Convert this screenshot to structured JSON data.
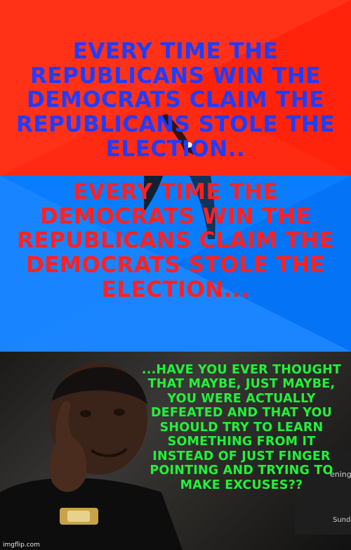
{
  "panels": {
    "top_caption": "EVERY TIME THE REPUBLICANS WIN THE DEMOCRATS CLAIM THE REPUBLICANS STOLE THE ELECTION..",
    "middle_caption": "EVERY TIME THE DEMOCRATS WIN THE REPUBLICANS CLAIM THE DEMOCRATS STOLE THE ELECTION...",
    "bottom_caption": "...HAVE YOU EVER THOUGHT THAT MAYBE, JUST MAYBE, YOU WERE ACTUALLY DEFEATED AND THAT YOU SHOULD TRY TO LEARN SOMETHING FROM IT INSTEAD OF JUST FINGER POINTING AND TRYING TO MAKE EXCUSES??"
  },
  "watermark": "imgflip.com",
  "colors": {
    "red_bg": "#ff2a12",
    "blue_bg": "#0a7dff",
    "blue_text": "#1f3dff",
    "red_text": "#ff2121",
    "green_text": "#22f13a"
  }
}
